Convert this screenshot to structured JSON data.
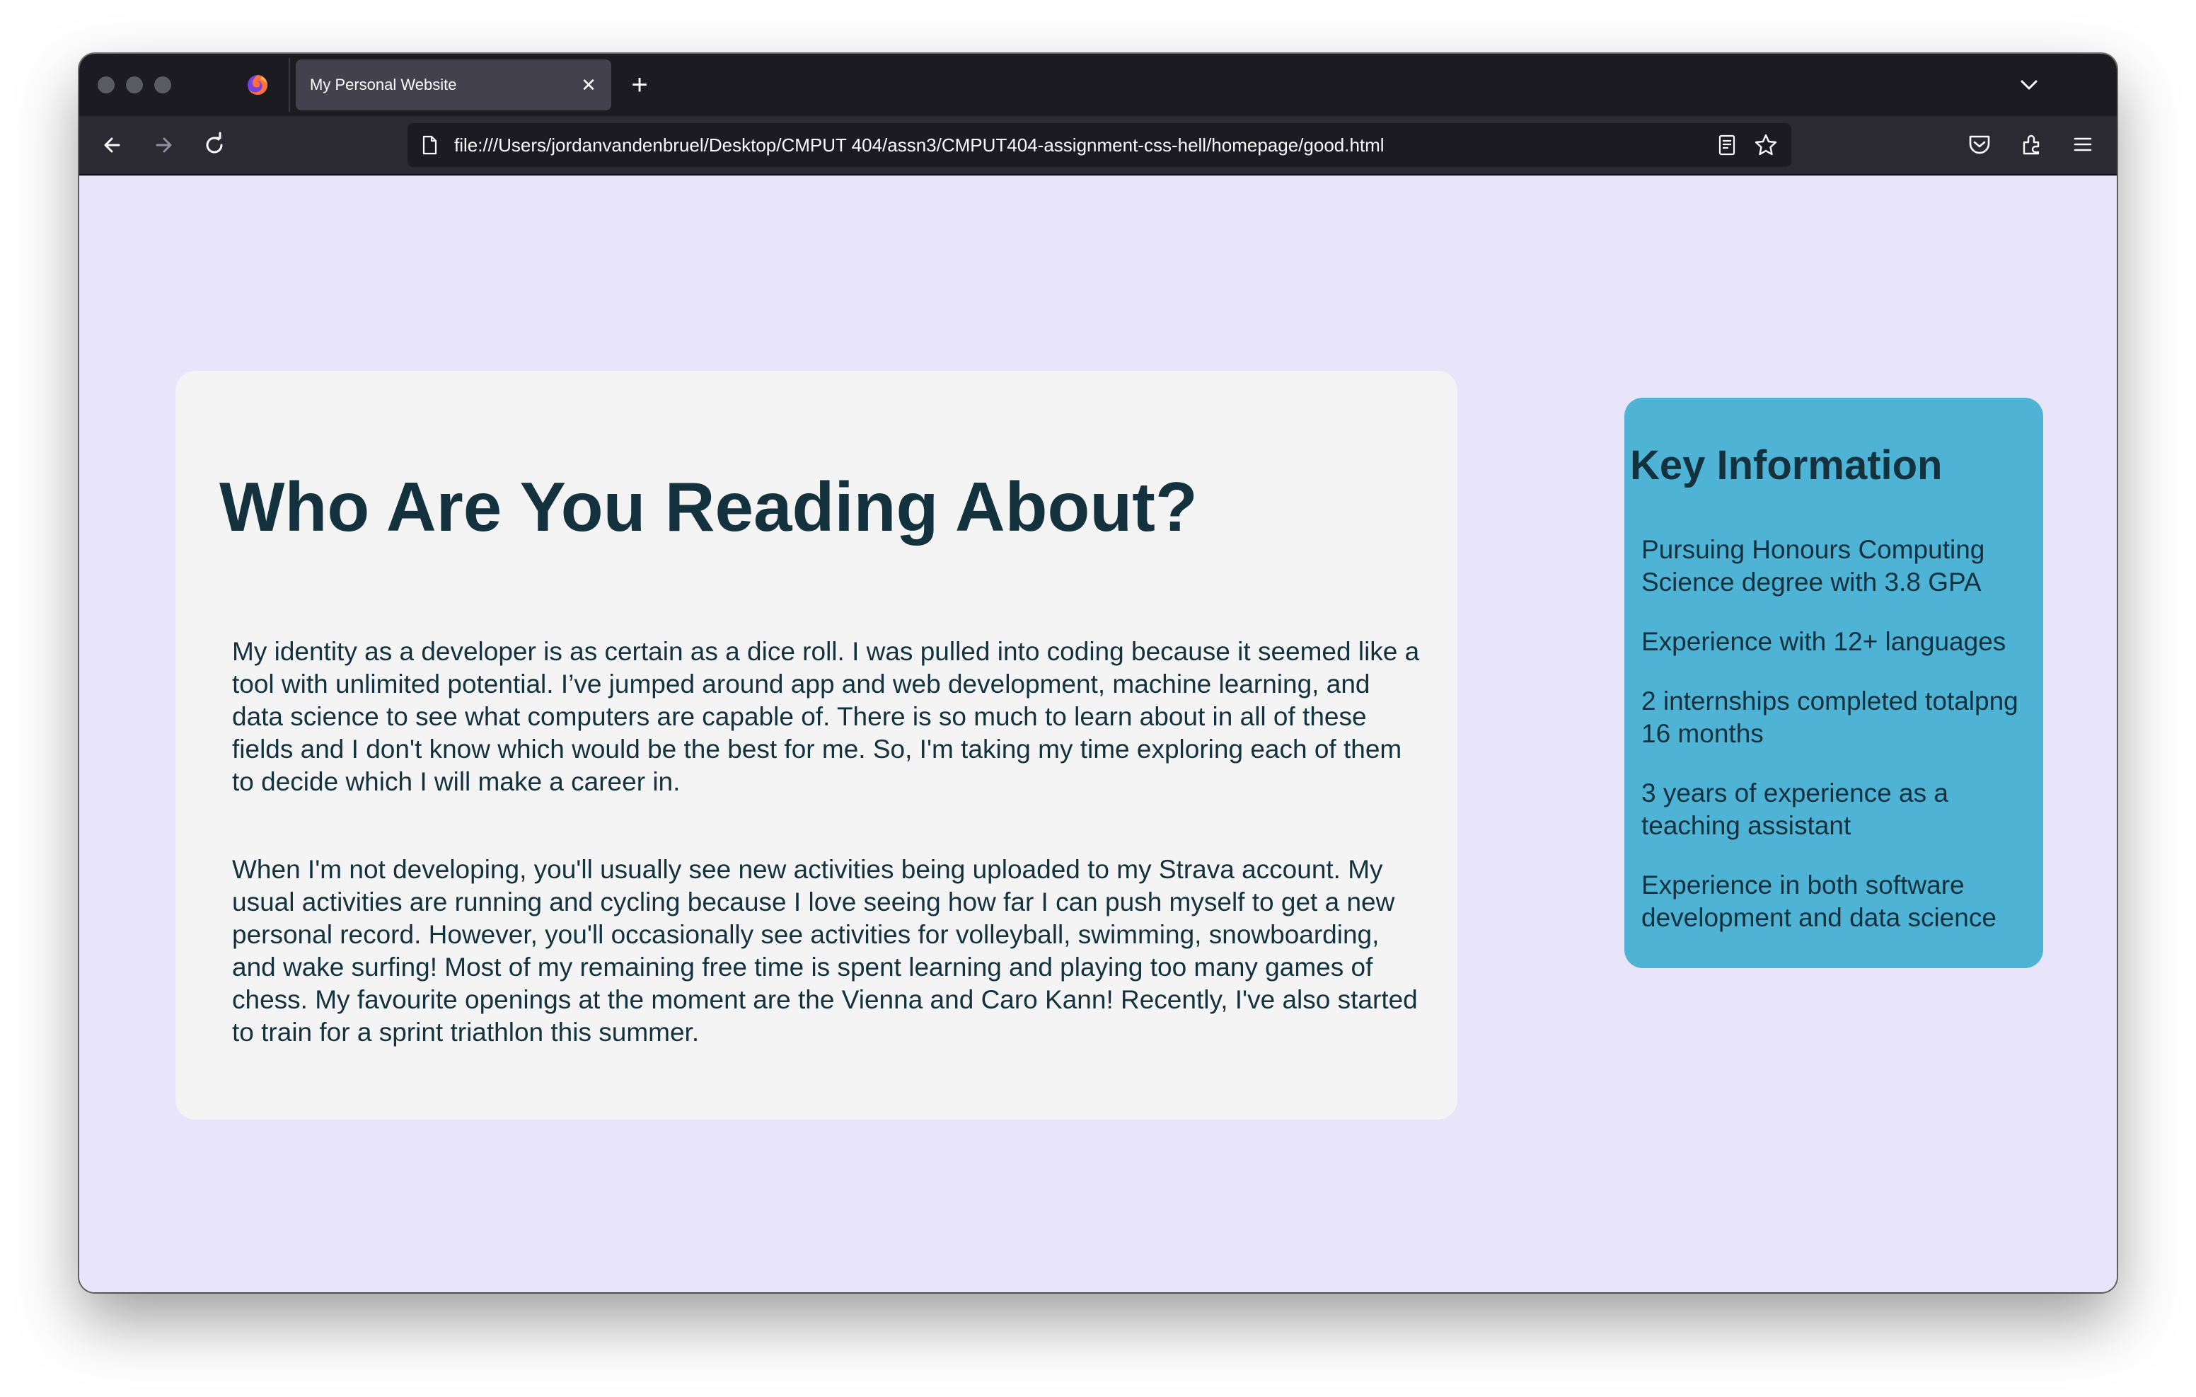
{
  "browser": {
    "tab_title": "My Personal Website",
    "url": "file:///Users/jordanvandenbruel/Desktop/CMPUT 404/assn3/CMPUT404-assignment-css-hell/homepage/good.html",
    "icons": [
      "firefox-logo-icon",
      "close-icon",
      "plus-icon",
      "chevron-down-icon",
      "back-arrow-icon",
      "forward-arrow-icon",
      "reload-icon",
      "page-icon",
      "reader-view-icon",
      "star-icon",
      "pocket-icon",
      "extensions-icon",
      "hamburger-menu-icon"
    ]
  },
  "about": {
    "heading": "Who Are You Reading About?",
    "paragraphs": [
      "My identity as a developer is as certain as a dice roll. I was pulled into coding because it seemed like a tool with unlimited potential. I’ve jumped around app and web development, machine learning, and data science to see what computers are capable of. There is so much to learn about in all of these fields and I don't know which would be the best for me. So, I'm taking my time exploring each of them to decide which I will make a career in.",
      "When I'm not developing, you'll usually see new activities being uploaded to my Strava account. My usual activities are running and cycling because I love seeing how far I can push myself to get a new personal record. However, you'll occasionally see activities for volleyball, swimming, snowboarding, and wake surfing! Most of my remaining free time is spent learning and playing too many games of chess. My favourite openings at the moment are the Vienna and Caro Kann! Recently, I've also started to train for a sprint triathlon this summer."
    ]
  },
  "key_info": {
    "heading": "Key Information",
    "items": [
      "Pursuing Honours Computing Science degree with 3.8 GPA",
      "Experience with 12+ languages",
      "2 internships completed totalpng 16 months",
      "3 years of experience as a teaching assistant",
      "Experience in both software development and data science"
    ]
  },
  "colors": {
    "page_background": "#e8e5fb",
    "about_card": "#f4f4f5",
    "key_card": "#4fb3d6",
    "text": "#13323d"
  }
}
